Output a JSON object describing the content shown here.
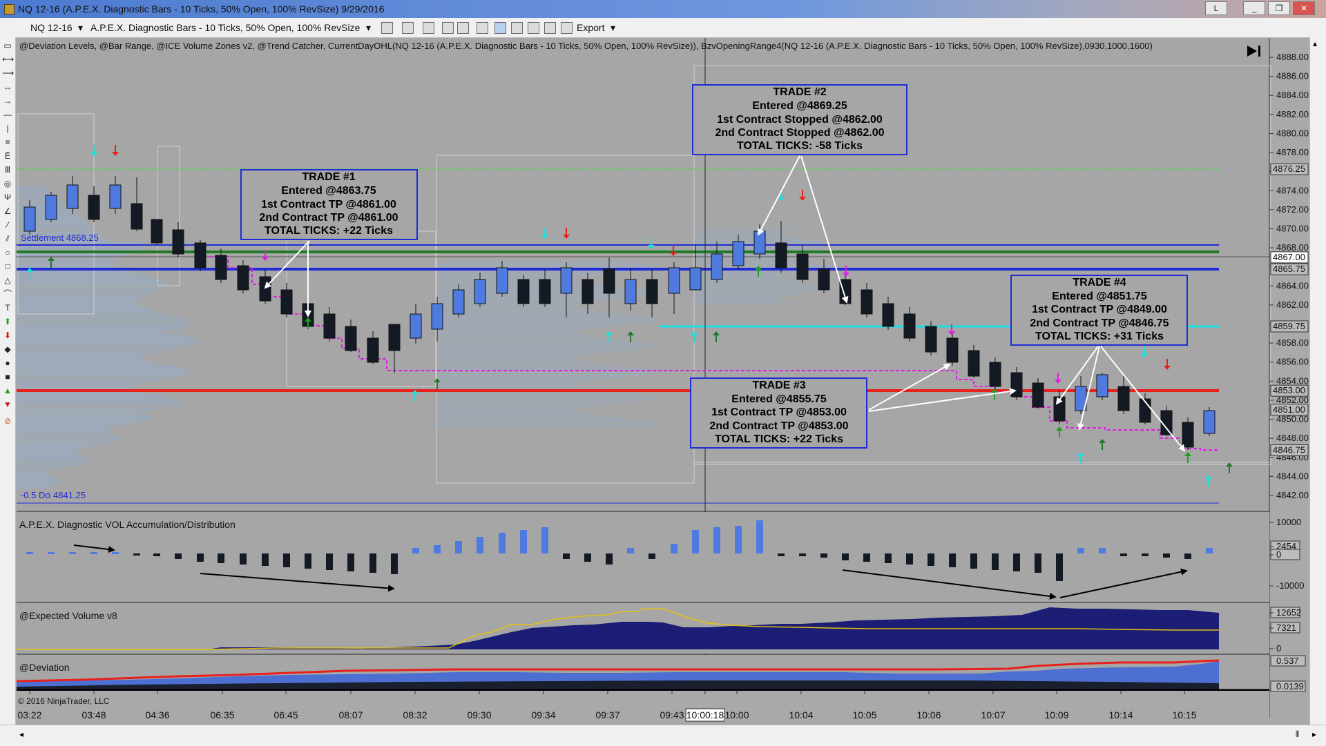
{
  "window": {
    "title": "NQ 12-16 (A.P.E.X. Diagnostic Bars - 10 Ticks, 50% Open, 100% RevSize)  9/29/2016",
    "buttons": [
      "L",
      "_",
      "❐",
      "✕"
    ]
  },
  "toolbar": {
    "instrument": "NQ 12-16",
    "bar_type": "A.P.E.X. Diagnostic Bars - 10 Ticks, 50% Open, 100% RevSize",
    "export_label": "Export"
  },
  "indicators_line": "@Deviation Levels, @Bar Range, @ICE Volume Zones v2, @Trend Catcher, CurrentDayOHL(NQ 12-16 (A.P.E.X. Diagnostic Bars - 10 Ticks, 50% Open, 100% RevSize)), BzvOpeningRange4(NQ 12-16 (A.P.E.X. Diagnostic Bars - 10 Ticks, 50% Open, 100% RevSize),0930,1000,1600)",
  "chart_labels": {
    "settlement": "Settlement 4868.25",
    "deviation": "-0.5 Dσ 4841.25",
    "copyright": "© 2016 NinjaTrader, LLC"
  },
  "panels": {
    "volume": "A.P.E.X. Diagnostic VOL Accumulation/Distribution",
    "expected": "@Expected Volume v8",
    "deviation": "@Deviation"
  },
  "trades": [
    {
      "name": "trade-1",
      "lines": [
        "TRADE #1",
        "Entered @4863.75",
        "1st Contract TP @4861.00",
        "2nd Contract TP @4861.00",
        "TOTAL TICKS: +22 Ticks"
      ]
    },
    {
      "name": "trade-2",
      "lines": [
        "TRADE #2",
        "Entered @4869.25",
        "1st Contract Stopped @4862.00",
        "2nd Contract Stopped @4862.00",
        "TOTAL TICKS: -58 Ticks"
      ]
    },
    {
      "name": "trade-3",
      "lines": [
        "TRADE #3",
        "Entered @4855.75",
        "1st Contract TP @4853.00",
        "2nd Contract TP @4853.00",
        "TOTAL TICKS: +22 Ticks"
      ]
    },
    {
      "name": "trade-4",
      "lines": [
        "TRADE #4",
        "Entered @4851.75",
        "1st Contract TP @4849.00",
        "2nd Contract TP @4846.75",
        "TOTAL TICKS: +31 Ticks"
      ]
    }
  ],
  "price_axis": {
    "ticks": [
      "4888.00",
      "4886.00",
      "4884.00",
      "4882.00",
      "4880.00",
      "4878.00",
      "4876.00",
      "4874.00",
      "4872.00",
      "4870.00",
      "4868.00",
      "4866.00",
      "4864.00",
      "4862.00",
      "4860.00",
      "4858.00",
      "4856.00",
      "4854.00",
      "4852.00",
      "4850.00",
      "4848.00",
      "4846.00",
      "4844.00",
      "4842.00"
    ],
    "boxed": [
      "4876.25",
      "4867.00",
      "4865.75",
      "4859.75",
      "4853.00",
      "4851.00",
      "4846.75"
    ]
  },
  "vol_axis": [
    "10000",
    "2454",
    "0",
    "-10000"
  ],
  "exp_axis": [
    "12652",
    "7321",
    "0"
  ],
  "dev_axis": [
    "0.537",
    "0.0139"
  ],
  "time_axis": [
    "03:22",
    "03:48",
    "04:36",
    "06:35",
    "06:45",
    "08:07",
    "08:32",
    "09:30",
    "09:34",
    "09:37",
    "09:43",
    "10:00:18",
    "10:00",
    "10:04",
    "10:05",
    "10:06",
    "10:07",
    "10:09",
    "10:14",
    "10:15"
  ],
  "colors": {
    "bull": "#4f7be0",
    "bear": "#141a24",
    "blue_line": "#1f2bd6",
    "red_line": "#e8201c",
    "green_line": "#1f7a26",
    "cyan_line": "#19e0e0",
    "magenta": "#e21ce4"
  }
}
